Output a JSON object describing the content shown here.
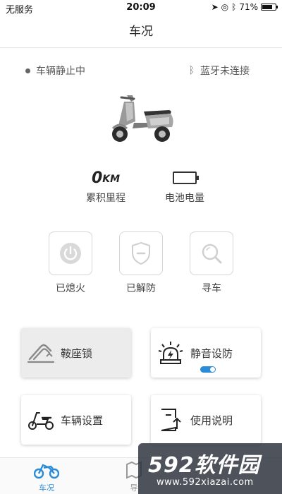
{
  "status_bar": {
    "carrier": "无服务",
    "time": "20:09",
    "battery_percent": "71%"
  },
  "nav": {
    "title": "车况"
  },
  "vehicle": {
    "state": "车辆静止中",
    "bluetooth": "蓝牙未连接"
  },
  "stats": {
    "mileage_value": "0",
    "mileage_unit": "KM",
    "mileage_label": "累积里程",
    "battery_label": "电池电量"
  },
  "controls": [
    {
      "label": "已熄火",
      "icon": "power-icon"
    },
    {
      "label": "已解防",
      "icon": "shield-minus-icon"
    },
    {
      "label": "寻车",
      "icon": "search-icon"
    }
  ],
  "cards": {
    "saddle_lock": "鞍座锁",
    "silent_arm": "静音设防",
    "silent_arm_enabled": true,
    "vehicle_settings": "车辆设置",
    "manual": "使用说明"
  },
  "tabs": [
    {
      "label": "车况",
      "active": true
    },
    {
      "label": "导"
    }
  ],
  "watermark": {
    "brand_num": "592",
    "brand_text": "软件园",
    "url": "www.592xiazai.com"
  },
  "colors": {
    "accent": "#2a8cd8"
  }
}
